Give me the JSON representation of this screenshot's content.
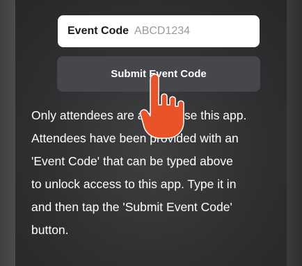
{
  "form": {
    "code_label": "Event Code",
    "code_placeholder": "ABCD1234",
    "submit_label": "Submit Event Code"
  },
  "description": {
    "lines": [
      "Only attendees are able to use this app.",
      "Attendees have been provided with an",
      "'Event Code' that can be typed above",
      "to unlock access to this app. Type it in",
      "and then tap the 'Submit Event Code'",
      "button."
    ]
  },
  "overlay": {
    "icon": "tap-hand-icon",
    "color": "#e8532a"
  }
}
